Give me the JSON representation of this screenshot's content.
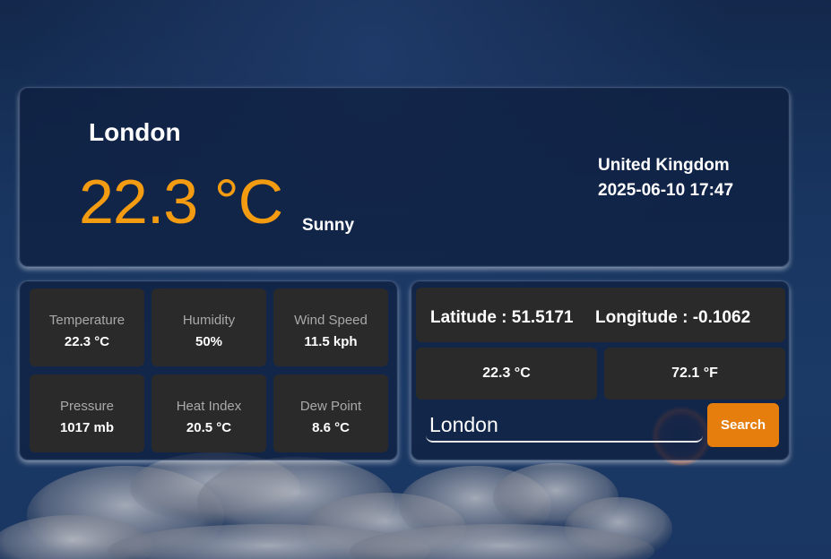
{
  "current": {
    "city": "London",
    "temperature": "22.3 °C",
    "condition": "Sunny",
    "country": "United Kingdom",
    "localtime": "2025-06-10 17:47"
  },
  "stats": [
    {
      "label": "Temperature",
      "value": "22.3 °C"
    },
    {
      "label": "Humidity",
      "value": "50%"
    },
    {
      "label": "Wind Speed",
      "value": "11.5 kph"
    },
    {
      "label": "Pressure",
      "value": "1017 mb"
    },
    {
      "label": "Heat Index",
      "value": "20.5 °C"
    },
    {
      "label": "Dew Point",
      "value": "8.6 °C"
    }
  ],
  "location": {
    "latitude": "Latitude : 51.5171",
    "longitude": "Longitude : -0.1062",
    "temp_c": "22.3 °C",
    "temp_f": "72.1 °F"
  },
  "search": {
    "value": "London",
    "button_label": "Search"
  },
  "colors": {
    "accent": "#f39c12",
    "button": "#e67e0e",
    "tile_bg": "#2a2a2b"
  }
}
